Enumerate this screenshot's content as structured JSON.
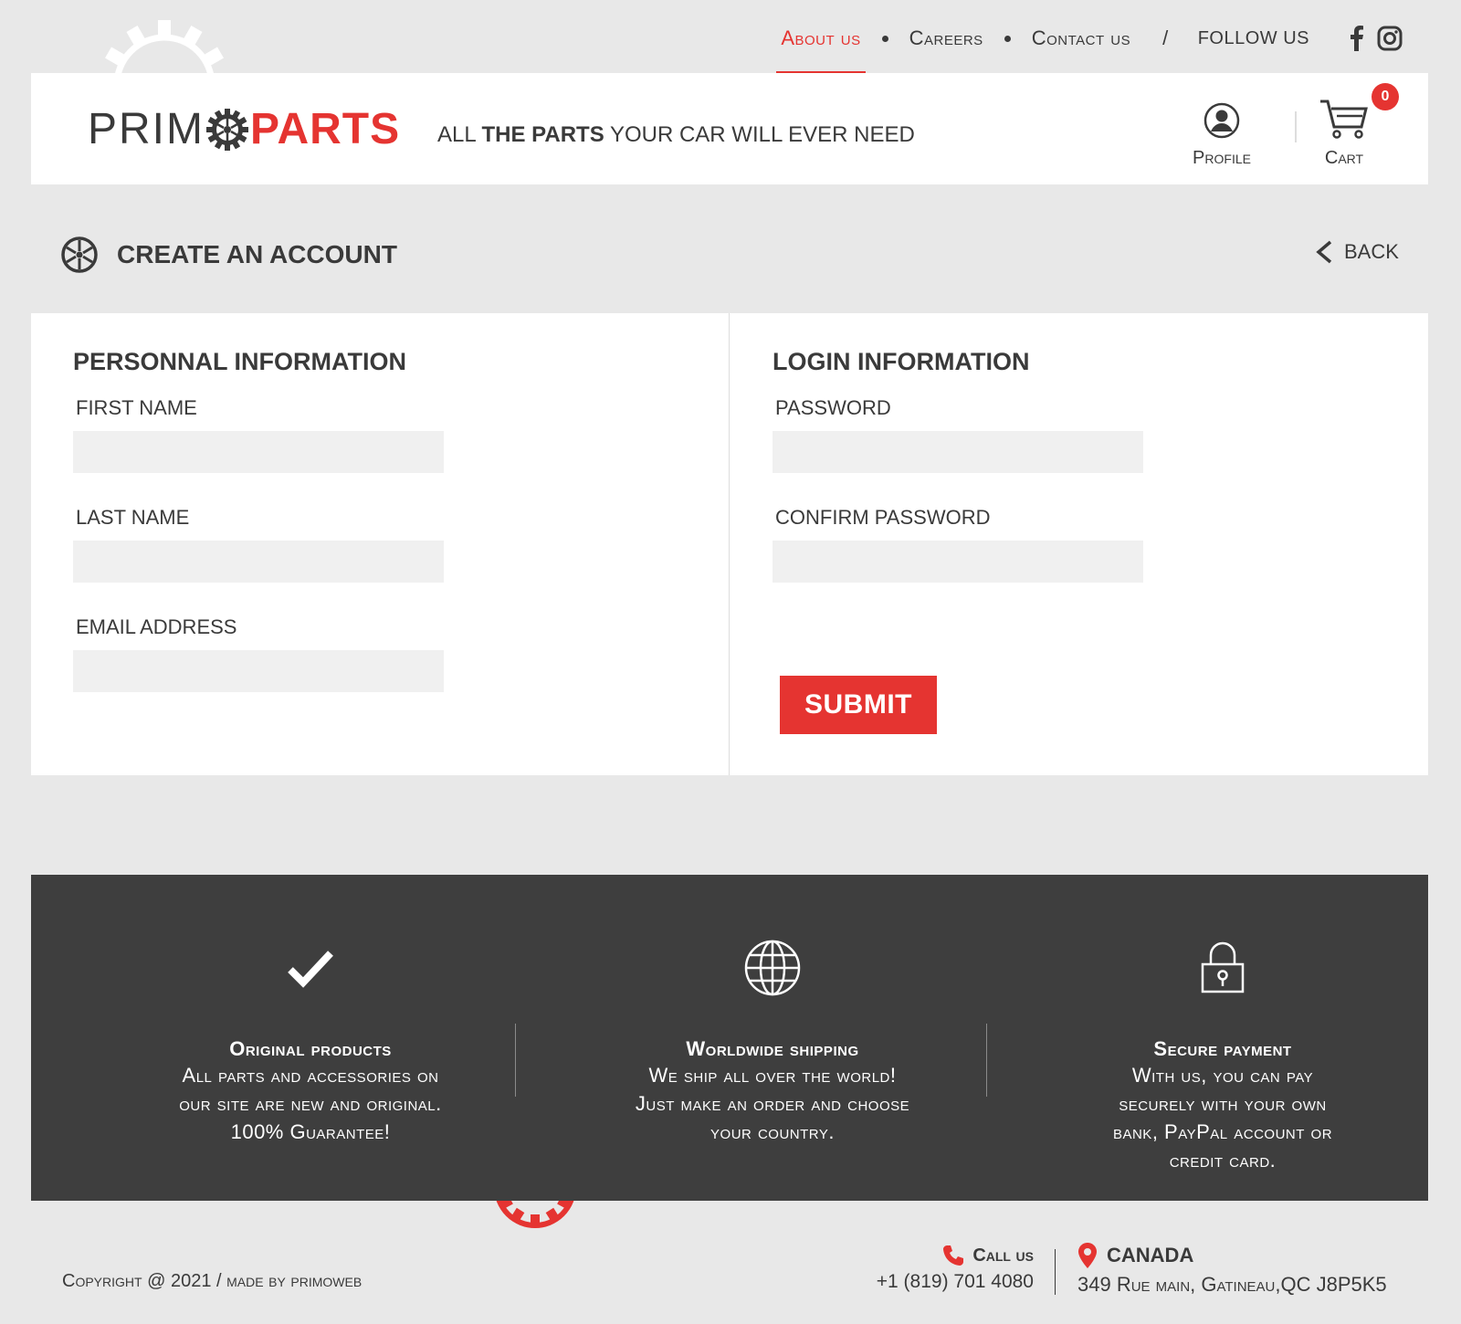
{
  "nav": {
    "about": "About us",
    "careers": "Careers",
    "contact": "Contact us",
    "slash": "/",
    "follow": "FOLLOW US"
  },
  "header": {
    "logo_left": "PRIM",
    "logo_right": "PARTS",
    "tagline_1": "ALL ",
    "tagline_2": "THE PARTS",
    "tagline_3": " YOUR CAR  WILL EVER NEED",
    "profile_label": "Profile",
    "cart_label": "Cart",
    "cart_count": "0"
  },
  "page": {
    "title": "CREATE AN ACCOUNT",
    "back_label": "BACK"
  },
  "form": {
    "personal_heading": "PERSONNAL INFORMATION",
    "first_name_label": "FIRST NAME",
    "first_name_value": "",
    "last_name_label": "LAST NAME",
    "last_name_value": "",
    "email_label": "EMAIL ADDRESS",
    "email_value": "",
    "login_heading": "LOGIN INFORMATION",
    "password_label": "PASSWORD",
    "password_value": "",
    "confirm_label": "CONFIRM PASSWORD",
    "confirm_value": "",
    "submit_label": "SUBMIT"
  },
  "features": [
    {
      "icon": "checkmark-icon",
      "title": "Original products",
      "desc_1": "All parts and accessories on",
      "desc_2": "our site are new and original.",
      "desc_3": "100% Guarantee!",
      "desc_4": ""
    },
    {
      "icon": "globe-icon",
      "title": "Worldwide shipping",
      "desc_1": "We ship all over the world!",
      "desc_2": "Just make an order and choose",
      "desc_3": "your country.",
      "desc_4": ""
    },
    {
      "icon": "padlock-icon",
      "title": "Secure payment",
      "desc_1": "With us, you can pay",
      "desc_2": "securely with your own",
      "desc_3": "bank, PayPal account or",
      "desc_4": "credit card."
    }
  ],
  "footer": {
    "copyright": "Copyright @ 2021 /  made by primoweb",
    "call_title": "Call us",
    "phone": "+1 (819) 701 4080",
    "location_title": "CANADA",
    "address": "349 Rue main, Gatineau,QC J8P5K5"
  },
  "colors": {
    "accent": "#e53431",
    "text": "#3a3a3a",
    "background": "#e8e8e8",
    "dark_band": "#3e3e3e",
    "input_bg": "#f0f0f0"
  }
}
